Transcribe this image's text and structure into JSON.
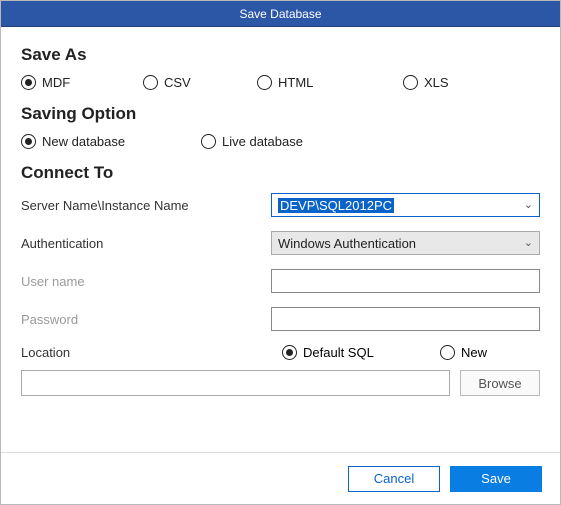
{
  "window": {
    "title": "Save Database"
  },
  "sections": {
    "saveAs": {
      "heading": "Save As",
      "options": {
        "mdf": "MDF",
        "csv": "CSV",
        "html": "HTML",
        "xls": "XLS"
      },
      "selected": "mdf"
    },
    "savingOption": {
      "heading": "Saving Option",
      "options": {
        "newdb": "New database",
        "livedb": "Live database"
      },
      "selected": "newdb"
    },
    "connectTo": {
      "heading": "Connect To",
      "serverLabel": "Server Name\\Instance Name",
      "serverValue": "DEVP\\SQL2012PC",
      "authLabel": "Authentication",
      "authValue": "Windows Authentication",
      "userLabel": "User name",
      "userValue": "",
      "passLabel": "Password",
      "passValue": "",
      "locationLabel": "Location",
      "locOptions": {
        "defaultSql": "Default SQL",
        "new": "New"
      },
      "locSelected": "defaultSql",
      "pathValue": "",
      "browseLabel": "Browse"
    }
  },
  "footer": {
    "cancel": "Cancel",
    "save": "Save"
  },
  "colors": {
    "accent": "#0a7de3",
    "header": "#2c56a6"
  }
}
